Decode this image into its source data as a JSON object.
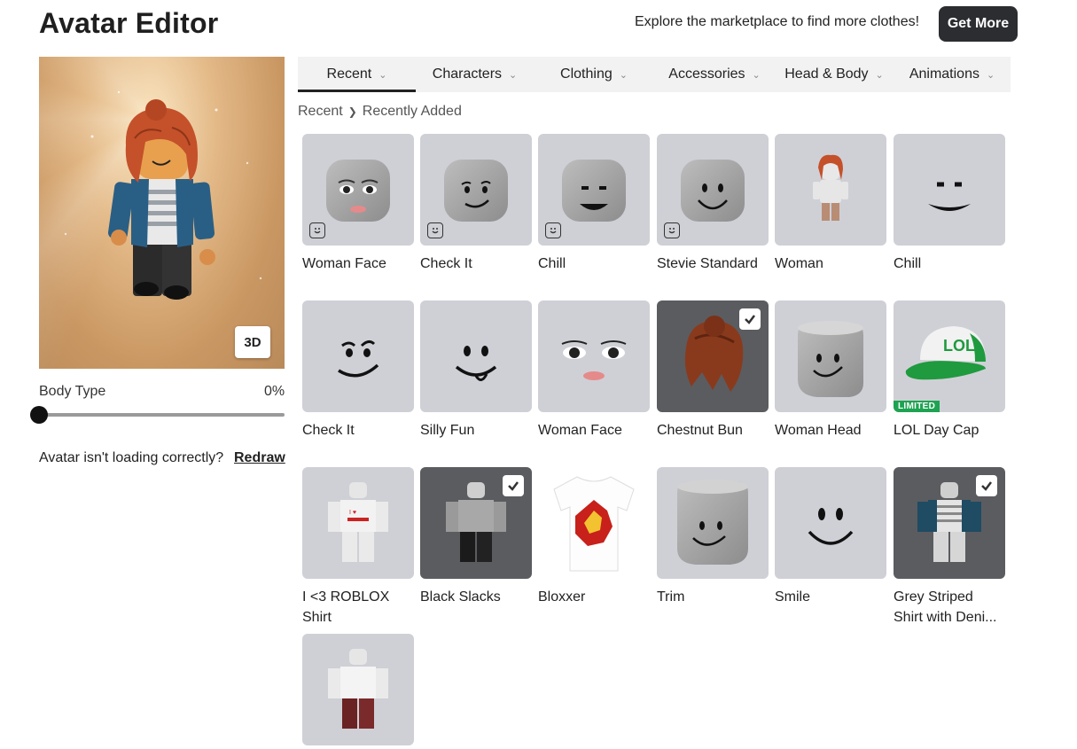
{
  "header": {
    "title": "Avatar Editor",
    "explore_text": "Explore the marketplace to find more clothes!",
    "get_more_label": "Get More"
  },
  "preview": {
    "view_toggle_label": "3D",
    "body_type_label": "Body Type",
    "body_type_value": "0%",
    "body_type_level": 0,
    "loading_message": "Avatar isn't loading correctly?",
    "redraw_label": "Redraw"
  },
  "tabs": [
    {
      "label": "Recent",
      "active": true
    },
    {
      "label": "Characters",
      "active": false
    },
    {
      "label": "Clothing",
      "active": false
    },
    {
      "label": "Accessories",
      "active": false
    },
    {
      "label": "Head & Body",
      "active": false
    },
    {
      "label": "Animations",
      "active": false
    }
  ],
  "breadcrumb": {
    "root": "Recent",
    "current": "Recently Added",
    "separator_icon": "chevron-right-icon"
  },
  "items": [
    {
      "name": "Woman Face",
      "icon": "woman-face-thumbnail",
      "badge": "face-icon"
    },
    {
      "name": "Check It",
      "icon": "check-it-face-thumbnail",
      "badge": "face-icon"
    },
    {
      "name": "Chill",
      "icon": "chill-face-thumbnail",
      "badge": "face-icon"
    },
    {
      "name": "Stevie Standard",
      "icon": "stevie-standard-face-thumbnail",
      "badge": "face-icon"
    },
    {
      "name": "Woman",
      "icon": "woman-character-thumbnail"
    },
    {
      "name": "Chill",
      "icon": "chill-face-thumbnail"
    },
    {
      "name": "Check It",
      "icon": "check-it-face-thumbnail"
    },
    {
      "name": "Silly Fun",
      "icon": "silly-fun-face-thumbnail"
    },
    {
      "name": "Woman Face",
      "icon": "woman-face-thumbnail"
    },
    {
      "name": "Chestnut Bun",
      "icon": "chestnut-bun-hair-thumbnail",
      "selected": true
    },
    {
      "name": "Woman Head",
      "icon": "woman-head-thumbnail"
    },
    {
      "name": "LOL Day Cap",
      "icon": "lol-cap-thumbnail",
      "tag": "LIMITED",
      "cap_text": "LOL"
    },
    {
      "name": "I <3 ROBLOX Shirt",
      "icon": "roblox-shirt-thumbnail"
    },
    {
      "name": "Black Slacks",
      "icon": "black-slacks-thumbnail",
      "selected": true
    },
    {
      "name": "Bloxxer",
      "icon": "bloxxer-shirt-thumbnail"
    },
    {
      "name": "Trim",
      "icon": "trim-head-thumbnail"
    },
    {
      "name": "Smile",
      "icon": "smile-face-thumbnail"
    },
    {
      "name": "Grey Striped Shirt with Deni...",
      "icon": "striped-shirt-denim-thumbnail",
      "selected": true
    },
    {
      "name": "",
      "icon": "white-shirt-red-pants-thumbnail"
    }
  ],
  "colors": {
    "button_dark": "#2b2d31",
    "tile_bg": "#cfd0d6",
    "tile_selected_bg": "#5b5c60",
    "limited_green": "#1ea352",
    "hair": "#c4512a",
    "cap_green": "#1f9a3e"
  }
}
